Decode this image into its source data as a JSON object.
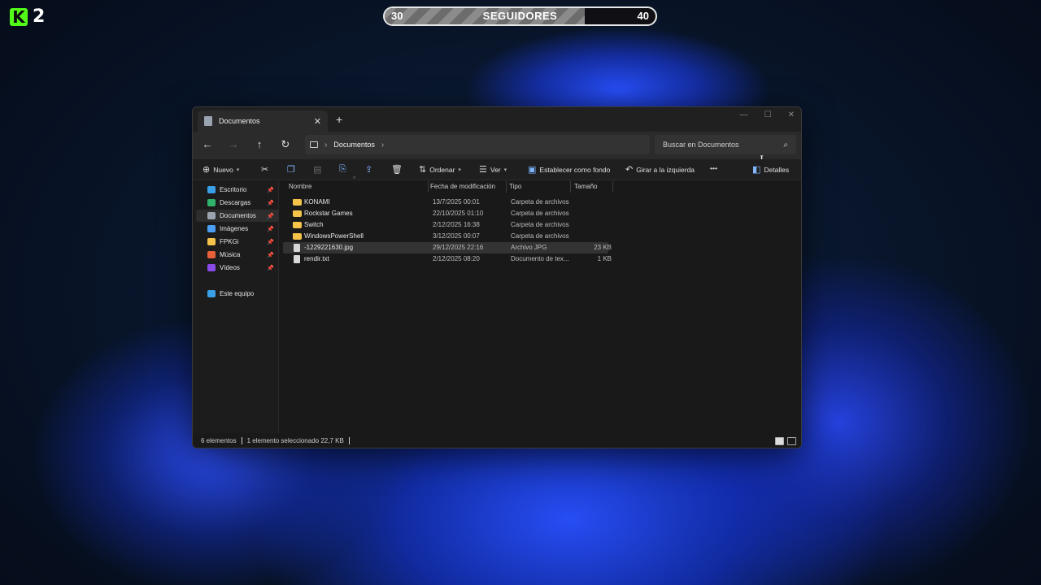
{
  "overlay": {
    "logo_letter": "K",
    "logo_number": "2",
    "followers": {
      "start": "30",
      "label": "SEGUIDORES",
      "end": "40",
      "progress_fraction": 0.74
    }
  },
  "window": {
    "tab_title": "Documentos",
    "new_tab": "+",
    "controls": {
      "minimize": "—",
      "maximize": "☐",
      "close": "✕"
    }
  },
  "nav": {
    "breadcrumb": "Documentos",
    "search_placeholder": "Buscar en Documentos"
  },
  "toolbar": {
    "new": "Nuevo",
    "sort": "Ordenar",
    "view": "Ver",
    "set_background": "Establecer como fondo",
    "rotate_left": "Girar a la izquierda",
    "more": "•••",
    "details": "Detalles"
  },
  "sidebar": {
    "items": [
      {
        "label": "Escritorio",
        "color": "#3aa0e8"
      },
      {
        "label": "Descargas",
        "color": "#2fb36a"
      },
      {
        "label": "Documentos",
        "color": "#9aa4b0"
      },
      {
        "label": "Imágenes",
        "color": "#4a9ff5"
      },
      {
        "label": "FPKGi",
        "color": "#f6c34a"
      },
      {
        "label": "Música",
        "color": "#e8603a"
      },
      {
        "label": "Vídeos",
        "color": "#8a4ae8"
      }
    ],
    "this_pc": "Este equipo"
  },
  "columns": {
    "name": "Nombre",
    "date": "Fecha de modificación",
    "type": "Tipo",
    "size": "Tamaño"
  },
  "files": [
    {
      "name": "KONAMI",
      "date": "13/7/2025 00:01",
      "type": "Carpeta de archivos",
      "size": "",
      "kind": "folder"
    },
    {
      "name": "Rockstar Games",
      "date": "22/10/2025 01:10",
      "type": "Carpeta de archivos",
      "size": "",
      "kind": "folder"
    },
    {
      "name": "Switch",
      "date": "2/12/2025 16:38",
      "type": "Carpeta de archivos",
      "size": "",
      "kind": "folder"
    },
    {
      "name": "WindowsPowerShell",
      "date": "3/12/2025 00:07",
      "type": "Carpeta de archivos",
      "size": "",
      "kind": "folder"
    },
    {
      "name": "-1229221630.jpg",
      "date": "29/12/2025 22:16",
      "type": "Archivo JPG",
      "size": "23 KB",
      "kind": "file"
    },
    {
      "name": "rendir.txt",
      "date": "2/12/2025 08:20",
      "type": "Documento de tex...",
      "size": "1 KB",
      "kind": "file"
    }
  ],
  "status": {
    "count": "6 elementos",
    "selection": "1 elemento seleccionado  22,7 KB"
  }
}
